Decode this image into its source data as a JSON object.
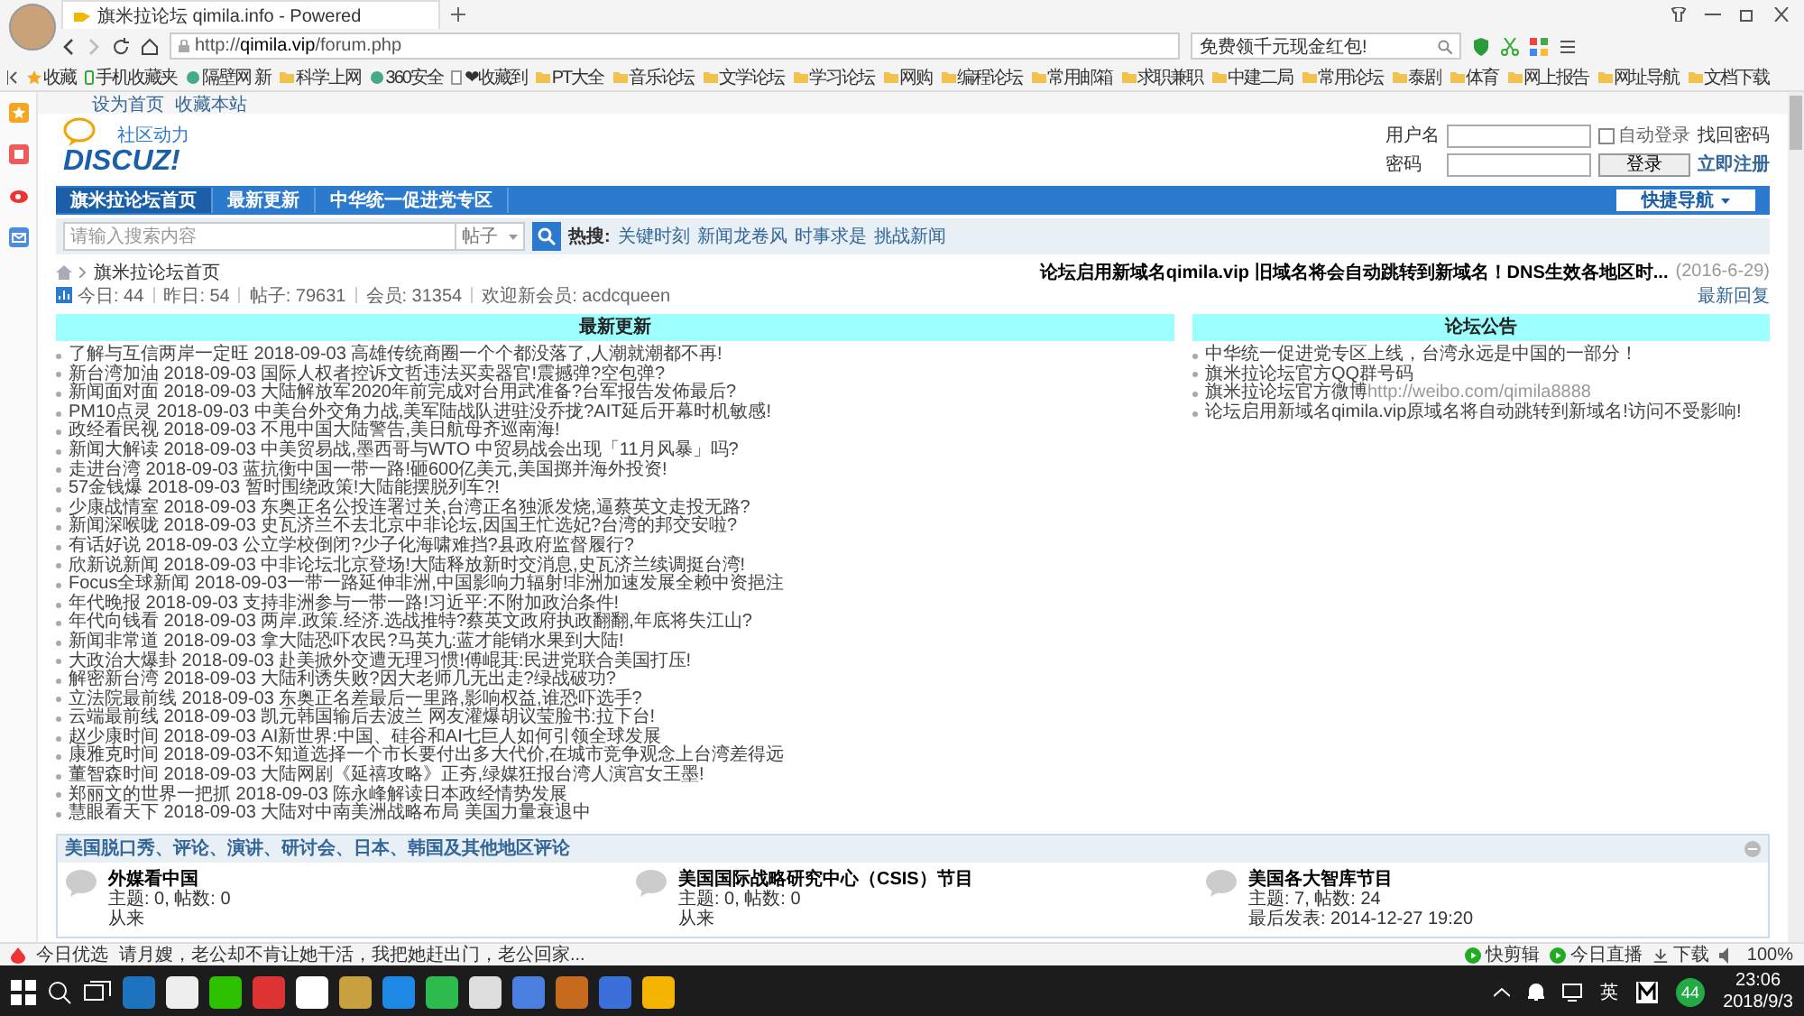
{
  "browser": {
    "tab_title": "旗米拉论坛 qimila.info - Powered",
    "url_scheme": "http://",
    "url_host": "qimila.vip",
    "url_path": "/forum.php",
    "search_placeholder": "免费领千元现金红包!",
    "bookmarks": [
      {
        "label": "收藏",
        "kind": "star"
      },
      {
        "label": "手机收藏夹",
        "kind": "phone"
      },
      {
        "label": "隔壁网 新",
        "kind": "site"
      },
      {
        "label": "科学上网",
        "kind": "folder"
      },
      {
        "label": "360安全",
        "kind": "site"
      },
      {
        "label": "❤收藏到",
        "kind": "page"
      },
      {
        "label": "PT大全",
        "kind": "folder"
      },
      {
        "label": "音乐论坛",
        "kind": "folder"
      },
      {
        "label": "文学论坛",
        "kind": "folder"
      },
      {
        "label": "学习论坛",
        "kind": "folder"
      },
      {
        "label": "网购",
        "kind": "folder"
      },
      {
        "label": "编程论坛",
        "kind": "folder"
      },
      {
        "label": "常用邮箱",
        "kind": "folder"
      },
      {
        "label": "求职兼职",
        "kind": "folder"
      },
      {
        "label": "中建二局",
        "kind": "folder"
      },
      {
        "label": "常用论坛",
        "kind": "folder"
      },
      {
        "label": "泰剧",
        "kind": "folder"
      },
      {
        "label": "体育",
        "kind": "folder"
      },
      {
        "label": "网上报告",
        "kind": "folder"
      },
      {
        "label": "网址导航",
        "kind": "folder"
      },
      {
        "label": "文档下载",
        "kind": "folder"
      }
    ]
  },
  "top_links": [
    "设为首页",
    "收藏本站"
  ],
  "logo": {
    "tagline": "社区动力",
    "wordmark": "DISCUZ!"
  },
  "login": {
    "username_label": "用户名",
    "password_label": "密码",
    "auto_login": {
      "label": "自动登录",
      "checked": false
    },
    "forgot": "找回密码",
    "login_button": "登录",
    "register": "立即注册"
  },
  "nav": {
    "items": [
      {
        "label": "旗米拉论坛首页",
        "selected": true
      },
      {
        "label": "最新更新",
        "selected": false
      },
      {
        "label": "中华统一促进党专区",
        "selected": false
      }
    ],
    "quick_nav": "快捷导航"
  },
  "search": {
    "placeholder": "请输入搜索内容",
    "scope": "帖子",
    "hot_label": "热搜:",
    "hot": [
      "关键时刻",
      "新闻龙卷风",
      "时事求是",
      "挑战新闻"
    ]
  },
  "breadcrumb": [
    "旗米拉论坛首页"
  ],
  "announcement": {
    "text": "论坛启用新域名qimila.vip 旧域名将会自动跳转到新域名！DNS生效各地区时...",
    "date": "(2016-6-29)"
  },
  "stats": [
    "今日: 44",
    "昨日: 54",
    "帖子: 79631",
    "会员: 31354",
    "欢迎新会员: acdcqueen"
  ],
  "latest_reply": "最新回复",
  "news": {
    "title": "最新更新",
    "items": [
      "了解与互信两岸一定旺 2018-09-03 高雄传统商圈一个个都没落了,人潮就潮都不再!",
      "新台湾加油 2018-09-03 国际人权者控诉文哲违法买卖器官!震撼弹?空包弹?",
      "新闻面对面 2018-09-03 大陆解放军2020年前完成对台用武准备?台军报告发佈最后?",
      "PM10点灵 2018-09-03 中美台外交角力战,美军陆战队进驻没乔拢?AIT延后开幕时机敏感!",
      "政经看民视 2018-09-03 不甩中国大陆警告,美日航母齐巡南海!",
      "新闻大解读 2018-09-03 中美贸易战,墨西哥与WTO 中贸易战会出现「11月风暴」吗?",
      "走进台湾 2018-09-03 蓝抗衡中国一带一路!砸600亿美元,美国掷并海外投资!",
      "57金钱爆 2018-09-03 暂时围绕政策!大陆能摆脱列车?!",
      "少康战情室 2018-09-03 东奥正名公投连署过关,台湾正名独派发烧,逼蔡英文走投无路?",
      "新闻深喉咙 2018-09-03 史瓦济兰不去北京中非论坛,因国王忙选妃?台湾的邦交安啦?",
      "有话好说 2018-09-03 公立学校倒闭?少子化海啸难挡?县政府监督履行?",
      "欣新说新闻 2018-09-03 中非论坛北京登场!大陆释放新时交消息,史瓦济兰续调挺台湾!",
      "Focus全球新闻 2018-09-03一带一路延伸非洲,中国影响力辐射!非洲加速发展全赖中资挹注",
      "年代晚报 2018-09-03 支持非洲参与一带一路!习近平:不附加政治条件!",
      "年代向钱看 2018-09-03 两岸.政策.经济.选战推特?蔡英文政府执政翻翻,年底将失江山?",
      "新闻非常道 2018-09-03 拿大陆恐吓农民?马英九:蓝才能销水果到大陆!",
      "大政治大爆卦 2018-09-03 赴美掀外交遭无理习惯!傅崐萁:民进党联合美国打压!",
      "解密新台湾 2018-09-03 大陆利诱失败?因大老师几无出走?绿战破功?",
      "立法院最前线 2018-09-03 东奥正名差最后一里路,影响权益,谁恐吓选手?",
      "云端最前线 2018-09-03 凯元韩国输后去波兰 网友灌爆胡议莹脸书:拉下台!",
      "赵少康时间 2018-09-03 AI新世界:中国、硅谷和AI七巨人如何引领全球发展",
      "康雅克时间 2018-09-03不知道选择一个市长要付出多大代价,在城市竞争观念上台湾差得远",
      "董智森时间 2018-09-03 大陆网剧《延禧攻略》正夯,绿媒狂报台湾人演宫女王墨!",
      "郑丽文的世界一把抓 2018-09-03 陈永峰解读日本政经情势发展",
      "慧眼看天下 2018-09-03 大陆对中南美洲战略布局 美国力量衰退中"
    ]
  },
  "notices": {
    "title": "论坛公告",
    "items": [
      {
        "text": "中华统一促进党专区上线，台湾永远是中国的一部分！"
      },
      {
        "text": "旗米拉论坛官方QQ群号码"
      },
      {
        "text": "旗米拉论坛官方微博",
        "link": "http://weibo.com/qimila8888"
      },
      {
        "text": "论坛启用新域名qimila.vip原域名将自动跳转到新域名!访问不受影响!"
      }
    ]
  },
  "category": {
    "title": "美国脱口秀、评论、演讲、研讨会、日本、韩国及其他地区评论",
    "forums": [
      {
        "name": "外媒看中国",
        "stats": "主题: 0, 帖数: 0",
        "last": "从来"
      },
      {
        "name": "美国国际战略研究中心（CSIS）节目",
        "stats": "主题: 0, 帖数: 0",
        "last": "从来"
      },
      {
        "name": "美国各大智库节目",
        "stats": "主题: 7, 帖数: 24",
        "last": "最后发表: 2014-12-27 19:20"
      }
    ]
  },
  "status_bar": {
    "label": "今日优选",
    "headline": "请月嫂，老公却不肯让她干活，我把她赶出门，老公回家...",
    "items": [
      {
        "label": "快剪辑",
        "kind": "play"
      },
      {
        "label": "今日直播",
        "kind": "play"
      },
      {
        "label": "下载",
        "kind": "download"
      }
    ],
    "zoom": "100%"
  },
  "taskbar": {
    "ime": "英",
    "badge": "44",
    "time": "23:06",
    "date": "2018/9/3"
  }
}
